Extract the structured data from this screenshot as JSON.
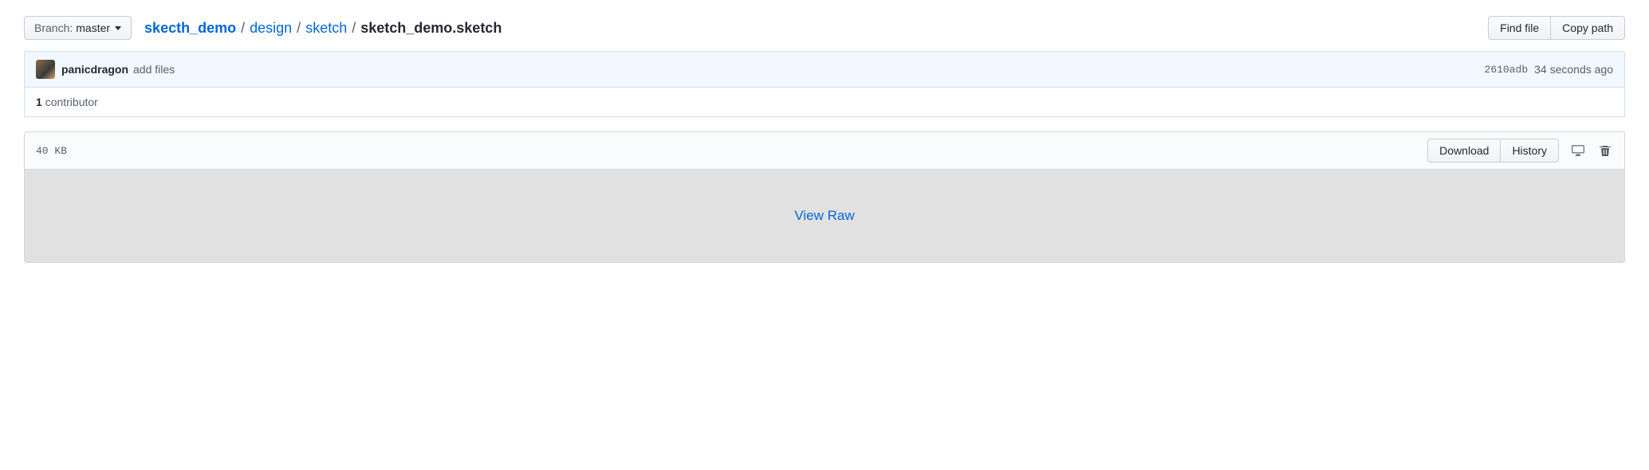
{
  "branch": {
    "label": "Branch:",
    "name": "master"
  },
  "breadcrumb": {
    "repo": "skecth_demo",
    "path": [
      "design",
      "sketch"
    ],
    "file": "sketch_demo.sketch"
  },
  "top_actions": {
    "find_file": "Find file",
    "copy_path": "Copy path"
  },
  "commit": {
    "author": "panicdragon",
    "message": "add files",
    "sha": "2610adb",
    "time": "34 seconds ago"
  },
  "contributors": {
    "count": "1",
    "label": "contributor"
  },
  "file": {
    "size": "40 KB",
    "actions": {
      "download": "Download",
      "history": "History"
    },
    "view_raw": "View Raw"
  }
}
